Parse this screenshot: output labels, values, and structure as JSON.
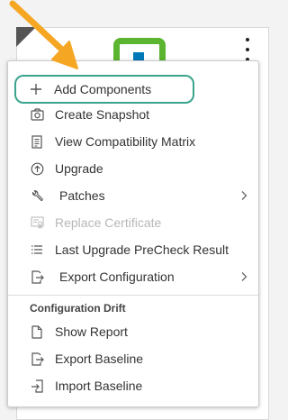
{
  "menu": {
    "items": [
      {
        "label": "Add Components",
        "icon": "plus-icon",
        "enabled": true,
        "highlighted": true
      },
      {
        "label": "Create Snapshot",
        "icon": "camera-icon",
        "enabled": true
      },
      {
        "label": "View Compatibility Matrix",
        "icon": "document-list-icon",
        "enabled": true
      },
      {
        "label": "Upgrade",
        "icon": "upgrade-circle-arrow-icon",
        "enabled": true
      },
      {
        "label": "Patches",
        "icon": "wrench-icon",
        "enabled": true,
        "submenu": true
      },
      {
        "label": "Replace Certificate",
        "icon": "certificate-icon",
        "enabled": false
      },
      {
        "label": "Last Upgrade PreCheck Result",
        "icon": "list-icon",
        "enabled": true
      },
      {
        "label": "Export Configuration",
        "icon": "export-icon",
        "enabled": true,
        "submenu": true
      }
    ],
    "section": {
      "header": "Configuration Drift",
      "items": [
        {
          "label": "Show Report",
          "icon": "document-icon",
          "enabled": true
        },
        {
          "label": "Export Baseline",
          "icon": "export-icon",
          "enabled": true
        },
        {
          "label": "Import Baseline",
          "icon": "import-icon",
          "enabled": true
        }
      ]
    }
  },
  "colors": {
    "highlight_border": "#3aa48c",
    "arrow": "#f5a623",
    "logo_green": "#5cb531",
    "logo_blue": "#0079b8",
    "disabled_text": "#b7b7b7"
  }
}
